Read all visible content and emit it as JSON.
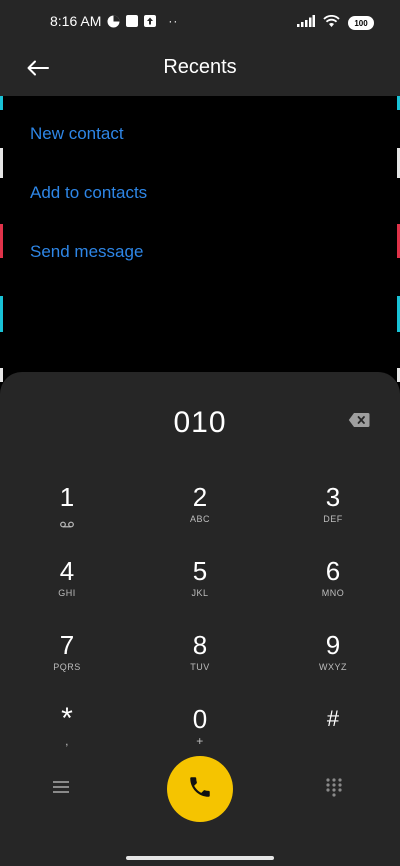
{
  "status_bar": {
    "time": "8:16 AM",
    "battery": "100",
    "overflow": "··"
  },
  "header": {
    "title": "Recents"
  },
  "actions": {
    "new_contact": "New contact",
    "add_to_contacts": "Add to contacts",
    "send_message": "Send message"
  },
  "dialpad": {
    "number": "010",
    "keys": [
      {
        "digit": "1",
        "letters": ""
      },
      {
        "digit": "2",
        "letters": "ABC"
      },
      {
        "digit": "3",
        "letters": "DEF"
      },
      {
        "digit": "4",
        "letters": "GHI"
      },
      {
        "digit": "5",
        "letters": "JKL"
      },
      {
        "digit": "6",
        "letters": "MNO"
      },
      {
        "digit": "7",
        "letters": "PQRS"
      },
      {
        "digit": "8",
        "letters": "TUV"
      },
      {
        "digit": "9",
        "letters": "WXYZ"
      },
      {
        "digit": "*",
        "letters": ","
      },
      {
        "digit": "0",
        "letters": "+"
      },
      {
        "digit": "#",
        "letters": ""
      }
    ]
  },
  "colors": {
    "accent_link": "#2e86e6",
    "call_button": "#f5c400",
    "panel": "#262626"
  },
  "icons": {
    "back": "arrow-left",
    "backspace": "backspace",
    "voicemail": "voicemail",
    "menu": "hamburger",
    "call": "phone",
    "keypad": "dialpad-grid"
  }
}
